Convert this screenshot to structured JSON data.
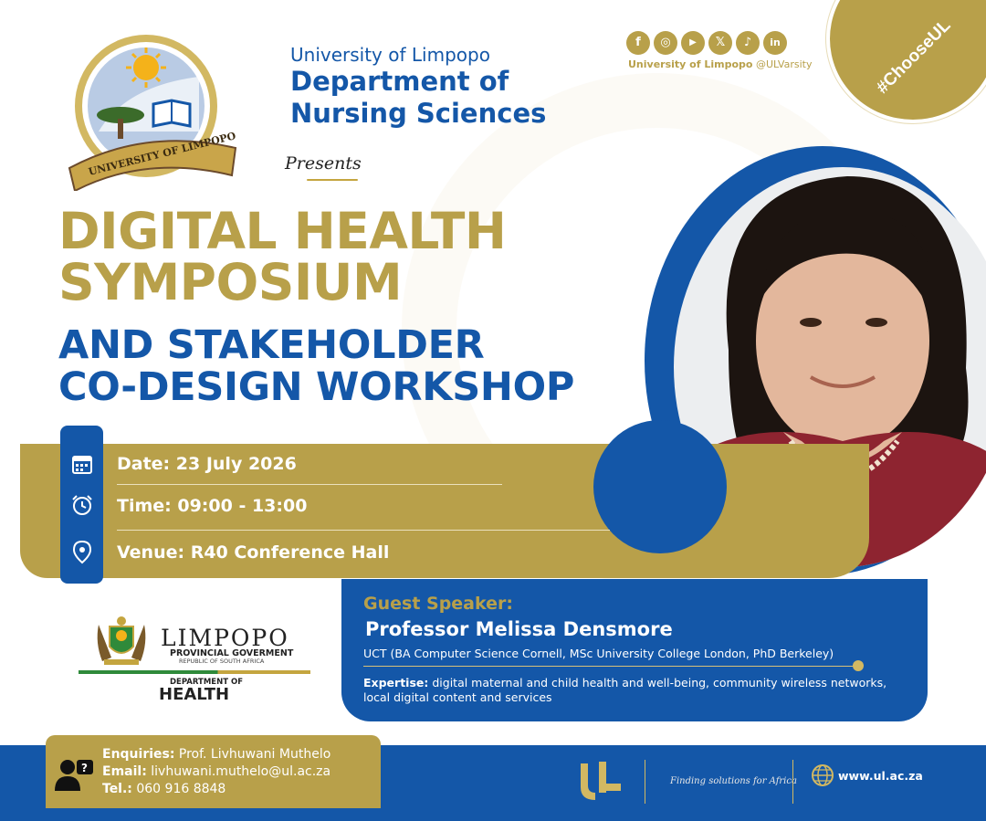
{
  "header": {
    "university": "University of Limpopo",
    "department": "Department of Nursing Sciences",
    "presents": "Presents",
    "logo_text": "UNIVERSITY OF LIMPOPO"
  },
  "social": {
    "icons": [
      "f",
      "◎",
      "▶",
      "𝕏",
      "♪",
      "in"
    ],
    "handle_prefix": "University of Limpopo",
    "handle": "@ULVarsity",
    "hashtag": "#ChooseUL"
  },
  "event": {
    "title_line1": "DIGITAL HEALTH",
    "title_line2": "SYMPOSIUM",
    "subtitle_line1": "AND STAKEHOLDER",
    "subtitle_line2": "CO-DESIGN WORKSHOP",
    "date": "Date: 23 July 2026",
    "time": "Time: 09:00 - 13:00",
    "venue": "Venue: R40 Conference Hall"
  },
  "speaker": {
    "label": "Guest Speaker:",
    "name": "Professor Melissa Densmore",
    "affiliation": "UCT (BA Computer Science Cornell, MSc University College London, PhD Berkeley)",
    "expertise_label": "Expertise:",
    "expertise": "digital maternal and child health and well-being, community wireless networks, local digital content and services"
  },
  "partner": {
    "name": "LIMPOPO",
    "line1": "PROVINCIAL GOVERMENT",
    "line2": "REPUBLIC OF SOUTH AFRICA",
    "dept": "DEPARTMENT OF",
    "health": "HEALTH"
  },
  "footer": {
    "enquiries_label": "Enquiries:",
    "enquiries": "Prof. Livhuwani Muthelo",
    "email_label": "Email:",
    "email": "livhuwani.muthelo@ul.ac.za",
    "tel_label": "Tel.:",
    "tel": "060 916 8848",
    "tagline": "Finding solutions for Africa",
    "website": "www.ul.ac.za"
  },
  "colors": {
    "gold": "#b8a04a",
    "blue": "#1457a8"
  }
}
